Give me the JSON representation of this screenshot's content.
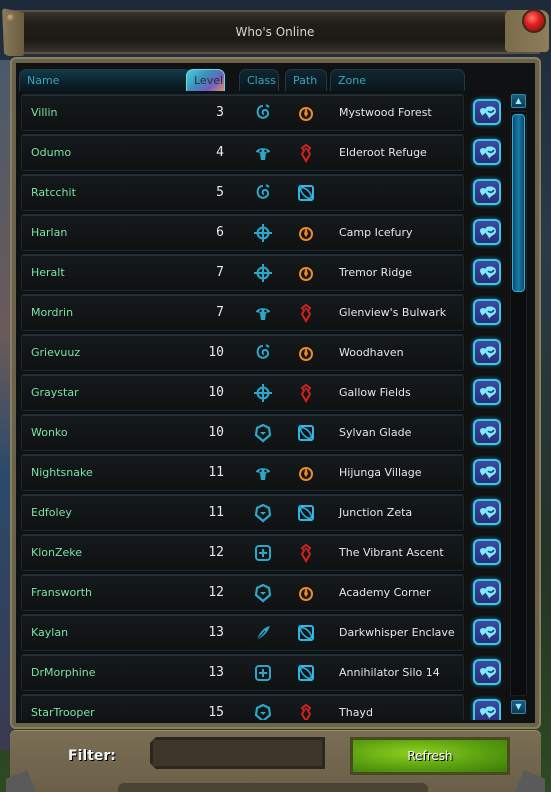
{
  "window": {
    "title": "Who's Online"
  },
  "columns": [
    {
      "key": "name",
      "label": "Name"
    },
    {
      "key": "level",
      "label": "Level",
      "sorted": true
    },
    {
      "key": "class",
      "label": "Class"
    },
    {
      "key": "path",
      "label": "Path"
    },
    {
      "key": "zone",
      "label": "Zone"
    }
  ],
  "players": [
    {
      "name": "Villin",
      "level": "3",
      "class": "spiral-icon",
      "path": "explorer-icon",
      "zone": "Mystwood Forest"
    },
    {
      "name": "Odumo",
      "level": "4",
      "class": "skull-icon",
      "path": "soldier-icon",
      "zone": "Elderoot Refuge"
    },
    {
      "name": "Ratcchit",
      "level": "5",
      "class": "spiral-icon",
      "path": "scientist-icon",
      "zone": ""
    },
    {
      "name": "Harlan",
      "level": "6",
      "class": "crosshair-icon",
      "path": "explorer-icon",
      "zone": "Camp Icefury"
    },
    {
      "name": "Heralt",
      "level": "7",
      "class": "crosshair-icon",
      "path": "explorer-icon",
      "zone": "Tremor Ridge"
    },
    {
      "name": "Mordrin",
      "level": "7",
      "class": "skull-icon",
      "path": "soldier-icon",
      "zone": "Glenview's Bulwark"
    },
    {
      "name": "Grievuuz",
      "level": "10",
      "class": "spiral-icon",
      "path": "explorer-icon",
      "zone": "Woodhaven"
    },
    {
      "name": "Graystar",
      "level": "10",
      "class": "crosshair-icon",
      "path": "soldier-icon",
      "zone": "Gallow Fields"
    },
    {
      "name": "Wonko",
      "level": "10",
      "class": "gear-shield-icon",
      "path": "scientist-icon",
      "zone": "Sylvan Glade"
    },
    {
      "name": "Nightsnake",
      "level": "11",
      "class": "skull-icon",
      "path": "explorer-icon",
      "zone": "Hijunga Village"
    },
    {
      "name": "Edfoley",
      "level": "11",
      "class": "gear-shield-icon",
      "path": "scientist-icon",
      "zone": "Junction Zeta"
    },
    {
      "name": "KlonZeke",
      "level": "12",
      "class": "medic-cross-icon",
      "path": "soldier-icon",
      "zone": "The Vibrant Ascent"
    },
    {
      "name": "Fransworth",
      "level": "12",
      "class": "gear-shield-icon",
      "path": "explorer-icon",
      "zone": "Academy Corner"
    },
    {
      "name": "Kaylan",
      "level": "13",
      "class": "feather-icon",
      "path": "scientist-icon",
      "zone": "Darkwhisper Enclave"
    },
    {
      "name": "DrMorphine",
      "level": "13",
      "class": "medic-cross-icon",
      "path": "scientist-icon",
      "zone": "Annihilator Silo 14"
    },
    {
      "name": "StarTrooper",
      "level": "15",
      "class": "gear-shield-icon",
      "path": "soldier-icon",
      "zone": "Thayd"
    }
  ],
  "scroll": {
    "up_glyph": "▲",
    "down_glyph": "▼",
    "position_fraction": 0
  },
  "footer": {
    "filter_label": "Filter:",
    "filter_value": "",
    "filter_placeholder": "",
    "refresh_label": "Refresh"
  },
  "colors": {
    "player_name": "#7de3a6",
    "level_text": "#e8e8e8",
    "zone_text": "#e6e6e6",
    "header_text": "#3ea3bf",
    "class_icon": "#2aa8c8",
    "path_explorer": "#f08a20",
    "path_soldier": "#d02020",
    "path_scientist": "#2ab8e8",
    "refresh_green": "#6ab818",
    "close_red": "#e02020"
  }
}
